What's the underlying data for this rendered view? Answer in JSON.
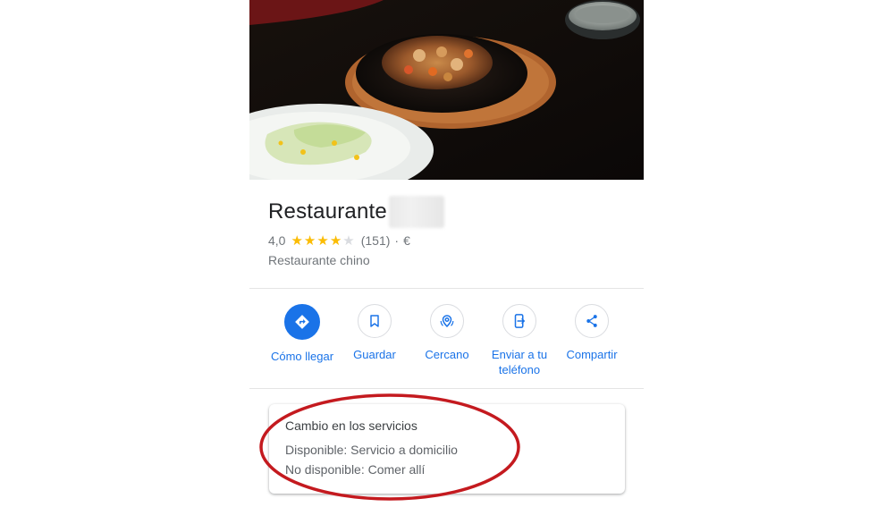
{
  "place": {
    "name": "Restaurante",
    "rating": "4,0",
    "stars": 4,
    "stars_max": 5,
    "review_count": "(151)",
    "separator": "·",
    "price": "€",
    "category": "Restaurante chino"
  },
  "actions": [
    {
      "label": "Cómo llegar",
      "icon": "directions-icon"
    },
    {
      "label": "Guardar",
      "icon": "bookmark-icon"
    },
    {
      "label": "Cercano",
      "icon": "nearby-icon"
    },
    {
      "label": "Enviar a tu teléfono",
      "icon": "send-to-phone-icon"
    },
    {
      "label": "Compartir",
      "icon": "share-icon"
    }
  ],
  "service_change": {
    "title": "Cambio en los servicios",
    "available": "Disponible: Servicio a domicilio",
    "unavailable": "No disponible: Comer allí"
  },
  "colors": {
    "accent": "#1a73e8",
    "star": "#fbbc04",
    "annotation": "#c41a1f"
  }
}
